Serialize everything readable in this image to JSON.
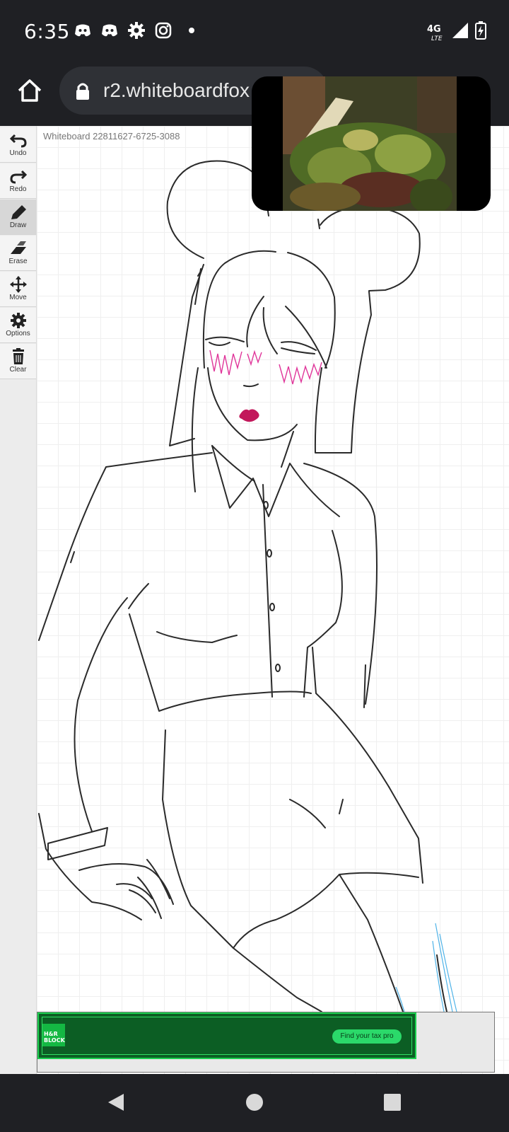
{
  "status": {
    "time": "6:35",
    "notification_icons": [
      "discord-icon",
      "discord-icon",
      "settings-icon",
      "instagram-icon",
      "dot-icon"
    ],
    "network": "4G LTE",
    "icons_right": [
      "signal-icon",
      "battery-charging-icon"
    ]
  },
  "browser": {
    "url": "r2.whiteboardfox",
    "icons": [
      "home-icon",
      "lock-icon"
    ]
  },
  "board": {
    "label": "Whiteboard 22811627-6725-3088"
  },
  "toolbar": {
    "tools": [
      {
        "label": "Undo",
        "icon": "undo-icon",
        "active": false
      },
      {
        "label": "Redo",
        "icon": "redo-icon",
        "active": false
      },
      {
        "label": "Draw",
        "icon": "pencil-icon",
        "active": true
      },
      {
        "label": "Erase",
        "icon": "eraser-icon",
        "active": false
      },
      {
        "label": "Move",
        "icon": "move-icon",
        "active": false
      },
      {
        "label": "Options",
        "icon": "gear-icon",
        "active": false
      },
      {
        "label": "Clear",
        "icon": "trash-icon",
        "active": false
      }
    ]
  },
  "ad": {
    "logo_text": "H&R BLOCK",
    "cta_label": "Find your tax pro",
    "colors": {
      "background": "#0c5e24",
      "accent": "#2bd96a"
    }
  },
  "colors": {
    "ink": "#2a2a2a",
    "blush": "#e0359a",
    "lips": "#c2185b",
    "blue_stroke": "#4fb3e8"
  }
}
